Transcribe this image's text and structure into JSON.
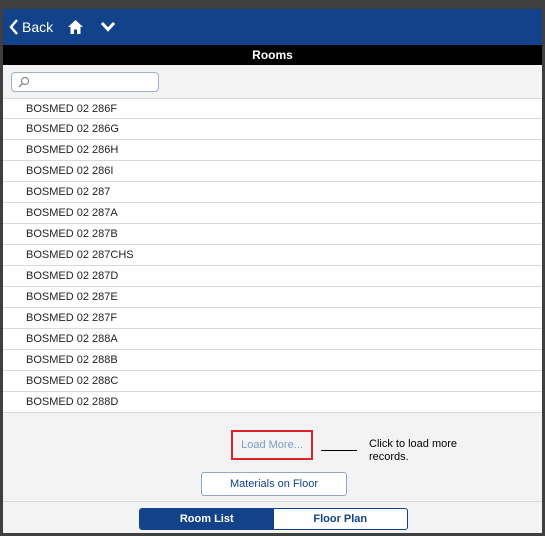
{
  "header": {
    "back_label": "Back",
    "home_icon": "home-icon",
    "chevron_icon": "chevron-down-icon"
  },
  "title": "Rooms",
  "search": {
    "placeholder": "",
    "value": ""
  },
  "rooms": [
    "BOSMED 02 286F",
    "BOSMED 02 286G",
    "BOSMED 02 286H",
    "BOSMED 02 286I",
    "BOSMED 02 287",
    "BOSMED 02 287A",
    "BOSMED 02 287B",
    "BOSMED 02 287CHS",
    "BOSMED 02 287D",
    "BOSMED 02 287E",
    "BOSMED 02 287F",
    "BOSMED 02 288A",
    "BOSMED 02 288B",
    "BOSMED 02 288C",
    "BOSMED 02 288D"
  ],
  "load_more_label": "Load More...",
  "callout_text": "Click to load more records.",
  "materials_button": "Materials on Floor",
  "tabs": [
    {
      "label": "Room List",
      "active": true
    },
    {
      "label": "Floor Plan",
      "active": false
    }
  ],
  "colors": {
    "brand": "#12428a",
    "highlight": "#d9242b"
  }
}
